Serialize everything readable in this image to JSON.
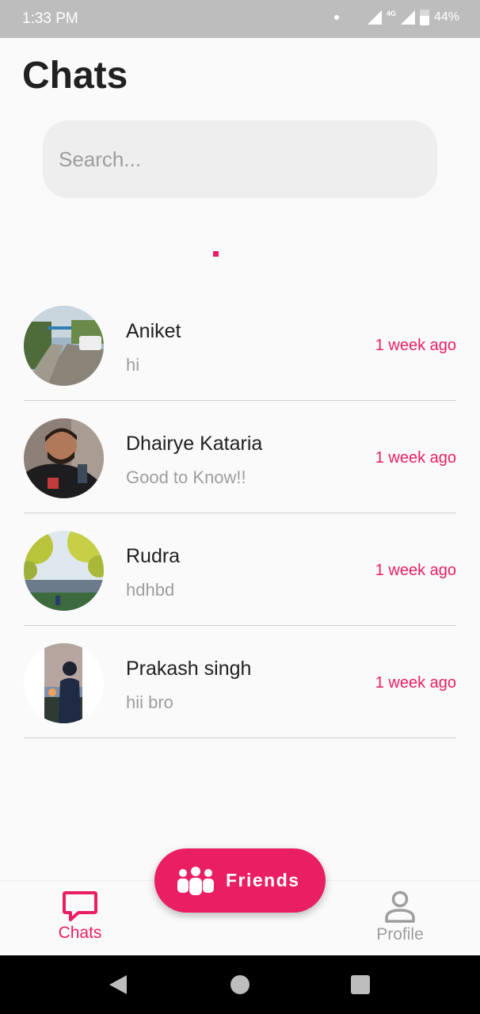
{
  "status_bar": {
    "time": "1:33 PM",
    "network": "4G",
    "battery": "44%"
  },
  "header": {
    "title": "Chats"
  },
  "search": {
    "placeholder": "Search..."
  },
  "colors": {
    "accent": "#e91e63",
    "muted": "#9e9e9e"
  },
  "chats": [
    {
      "name": "Aniket",
      "preview": "hi",
      "time": "1 week ago"
    },
    {
      "name": "Dhairye Kataria",
      "preview": "Good to Know!!",
      "time": "1 week ago"
    },
    {
      "name": "Rudra",
      "preview": "hdhbd",
      "time": "1 week ago"
    },
    {
      "name": "Prakash singh",
      "preview": "hii bro",
      "time": "1 week ago"
    }
  ],
  "fab": {
    "label": "Friends",
    "icon": "group-icon"
  },
  "bottom_nav": {
    "chats": {
      "label": "Chats",
      "icon": "chat-bubble-icon"
    },
    "profile": {
      "label": "Profile",
      "icon": "person-icon"
    }
  }
}
